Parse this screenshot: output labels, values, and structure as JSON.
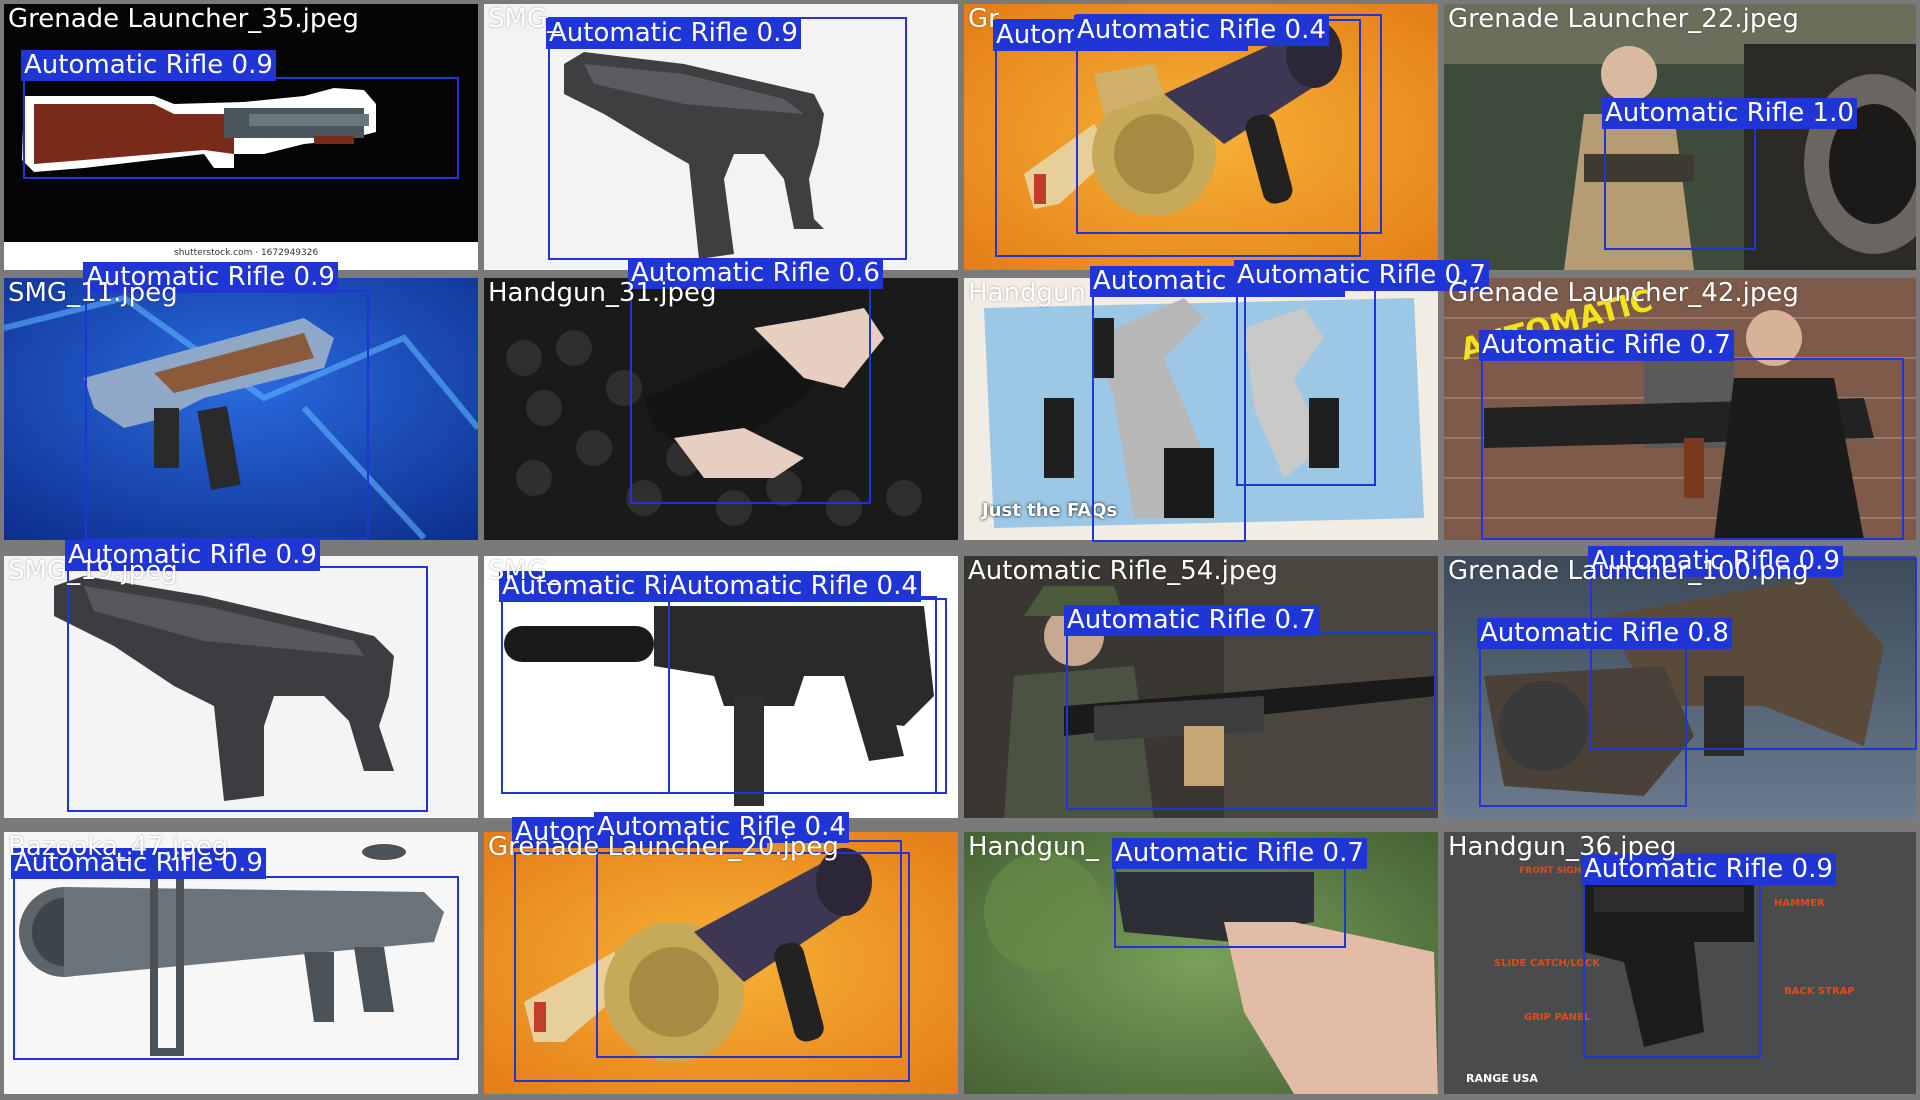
{
  "tiles": [
    {
      "filename": "Grenade Launcher_35.jpeg",
      "watermark": "shutterstock.com · 1672949326"
    },
    {
      "filename": "SMG_"
    },
    {
      "filename": "Gr"
    },
    {
      "filename": "Grenade Launcher_22.jpeg"
    },
    {
      "filename": "SMG_11.jpeg"
    },
    {
      "filename": "Handgun_31.jpeg"
    },
    {
      "filename": "Handgun",
      "caption": "Just the FAQs"
    },
    {
      "filename": "Grenade Launcher_42.jpeg",
      "overlay": "AUTOMATIC"
    },
    {
      "filename": "SMG_19.jpeg"
    },
    {
      "filename": "SMG_"
    },
    {
      "filename": "Automatic Rifle_54.jpeg"
    },
    {
      "filename": "Grenade Launcher_100.png"
    },
    {
      "filename": "Bazooka_47.jpeg"
    },
    {
      "filename": "Grenade Launcher_20.jpeg"
    },
    {
      "filename": "Handgun_"
    },
    {
      "filename": "Handgun_36.jpeg",
      "callouts": [
        "FRONT SIGHT",
        "HAMMER",
        "SLIDE CATCH/LOCK",
        "BACK STRAP",
        "GRIP PANEL"
      ],
      "brand": "RANGE USA"
    }
  ],
  "detections": [
    {
      "label": "Automatic Rifle 0.9"
    },
    {
      "label": "Automatic Rifle 0.9"
    },
    {
      "label": "Automatic Rifle 0.4"
    },
    {
      "label": "Automatic Rifle 0.4"
    },
    {
      "label": "Automatic Rifle 1.0"
    },
    {
      "label": "Automatic Rifle 0.9"
    },
    {
      "label": "Automatic Rifle 0.6"
    },
    {
      "label": "Automatic Rifle 0.4"
    },
    {
      "label": "Automatic Rifle 0.7"
    },
    {
      "label": "Automatic Rifle 0.7"
    },
    {
      "label": "Automatic Rifle 0.9"
    },
    {
      "label": "Automatic Rifle 0.4"
    },
    {
      "label": "Automatic Rifle 0.4"
    },
    {
      "label": "Automatic Rifle 0.7"
    },
    {
      "label": "Automatic Rifle 0.9"
    },
    {
      "label": "Automatic Rifle 0.8"
    },
    {
      "label": "Automatic Rifle 0.9"
    },
    {
      "label": "Automatic Rifle 0.4"
    },
    {
      "label": "Automatic Rifle 0.4"
    },
    {
      "label": "Automatic Rifle 0.7"
    },
    {
      "label": "Automatic Rifle 0.9"
    }
  ]
}
